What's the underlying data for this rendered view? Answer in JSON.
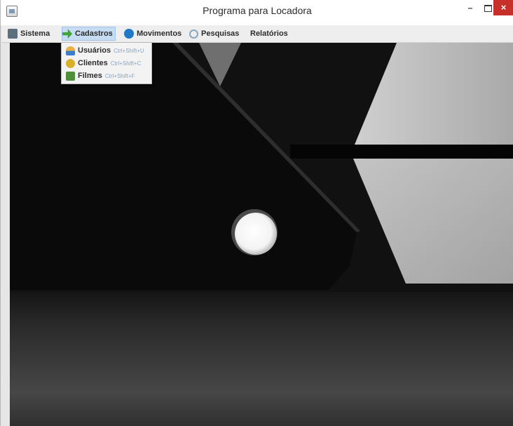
{
  "window": {
    "title": "Programa para Locadora"
  },
  "window_controls": {
    "minimize": "–",
    "close": "×"
  },
  "menubar": {
    "items": [
      {
        "label": "Sistema",
        "icon": "printer-icon"
      },
      {
        "label": "Cadastros",
        "icon": "green-arrow-icon",
        "active": true
      },
      {
        "label": "Movimentos",
        "icon": "blue-globe-icon"
      },
      {
        "label": "Pesquisas",
        "icon": "magnifier-icon"
      },
      {
        "label": "Relatórios",
        "icon": ""
      }
    ]
  },
  "cadastros_menu": {
    "items": [
      {
        "label": "Usuários",
        "shortcut": "Ctrl+Shift+U",
        "icon": "users-icon"
      },
      {
        "label": "Clientes",
        "shortcut": "Ctrl+Shift+C",
        "icon": "clients-icon"
      },
      {
        "label": "Filmes",
        "shortcut": "Ctrl+Shift+F",
        "icon": "film-icon"
      }
    ]
  },
  "colors": {
    "close_button": "#c7302a",
    "menu_highlight": "#c6dcf2",
    "shortcut_text": "#8aa3c4"
  }
}
